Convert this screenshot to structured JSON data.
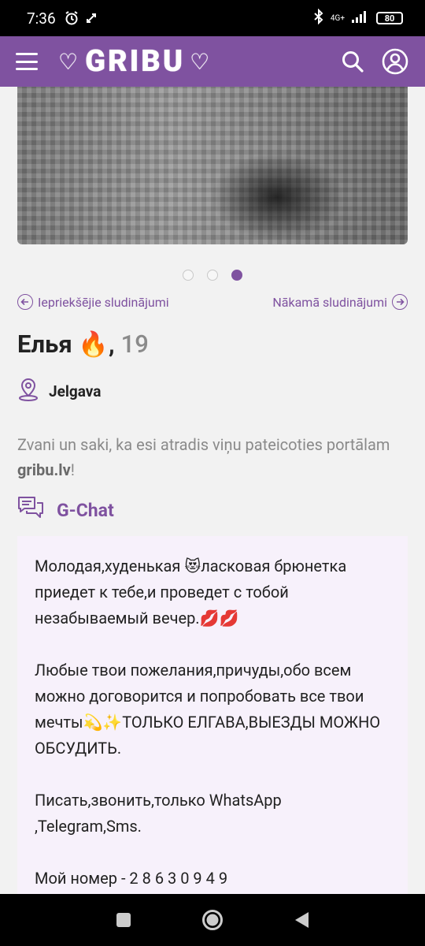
{
  "status_bar": {
    "time": "7:36",
    "network": "4G+",
    "battery": "80"
  },
  "header": {
    "logo": "GRIBU"
  },
  "carousel": {
    "total": 3,
    "active_index": 2
  },
  "nav": {
    "prev_label": "Iepriekšējie sludinājumi",
    "next_label": "Nākamā sludinājumi"
  },
  "profile": {
    "name": "Елья 🔥",
    "separator": ",",
    "age": "19",
    "city": "Jelgava"
  },
  "notice": {
    "text_before": "Zvani un saki, ka esi atradis viņu pateicoties portālam ",
    "site": "gribu.lv",
    "text_after": "!"
  },
  "gchat": {
    "label": "G-Chat"
  },
  "description": {
    "p1": "Молодая,худенькая 😻ласковая брюнетка приедет к тебе,и проведет с тобой незабываемый вечер.💋💋",
    "p2": "Любые твои пожелания,причуды,обо всем можно договорится и попробовать все твои мечты💫✨ТОЛЬКО ЕЛГАВА,ВЫЕЗДЫ МОЖНО ОБСУДИТЬ.",
    "p3": "Писать,звонить,только WhatsApp ,Telegram,Sms.",
    "p4": "Мой номер - 2 8 6 3 0 9 4 9"
  },
  "colors": {
    "brand": "#7f52a0",
    "panel": "#f7f1fb",
    "background": "#f2f2f2"
  }
}
